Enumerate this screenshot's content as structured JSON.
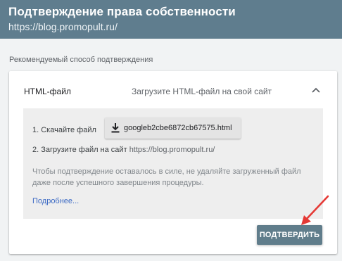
{
  "header": {
    "title": "Подтверждение права собственности",
    "url": "https://blog.promopult.ru/"
  },
  "section_label": "Рекомендуемый способ подтверждения",
  "method": {
    "name": "HTML-файл",
    "description": "Загрузите HTML-файл на свой сайт",
    "expanded": true,
    "chevron_icon": "chevron-up-icon"
  },
  "steps": {
    "step1_label": "1. Скачайте файл",
    "download_icon": "download-icon",
    "file_name": "googleb2cbe6872cb67575.html",
    "step2_label": "2. Загрузите файл на сайт",
    "step2_site": "https://blog.promopult.ru/"
  },
  "note": "Чтобы подтверждение оставалось в силе, не удаляйте загруженный файл даже после успешного завершения процедуры.",
  "more_link": "Подробнее...",
  "confirm_button": "ПОДТВЕРДИТЬ",
  "colors": {
    "header_bg": "#5f7d8e",
    "button_bg": "#607d8b",
    "link": "#3c6ac4",
    "annotation_arrow": "#e53935"
  }
}
